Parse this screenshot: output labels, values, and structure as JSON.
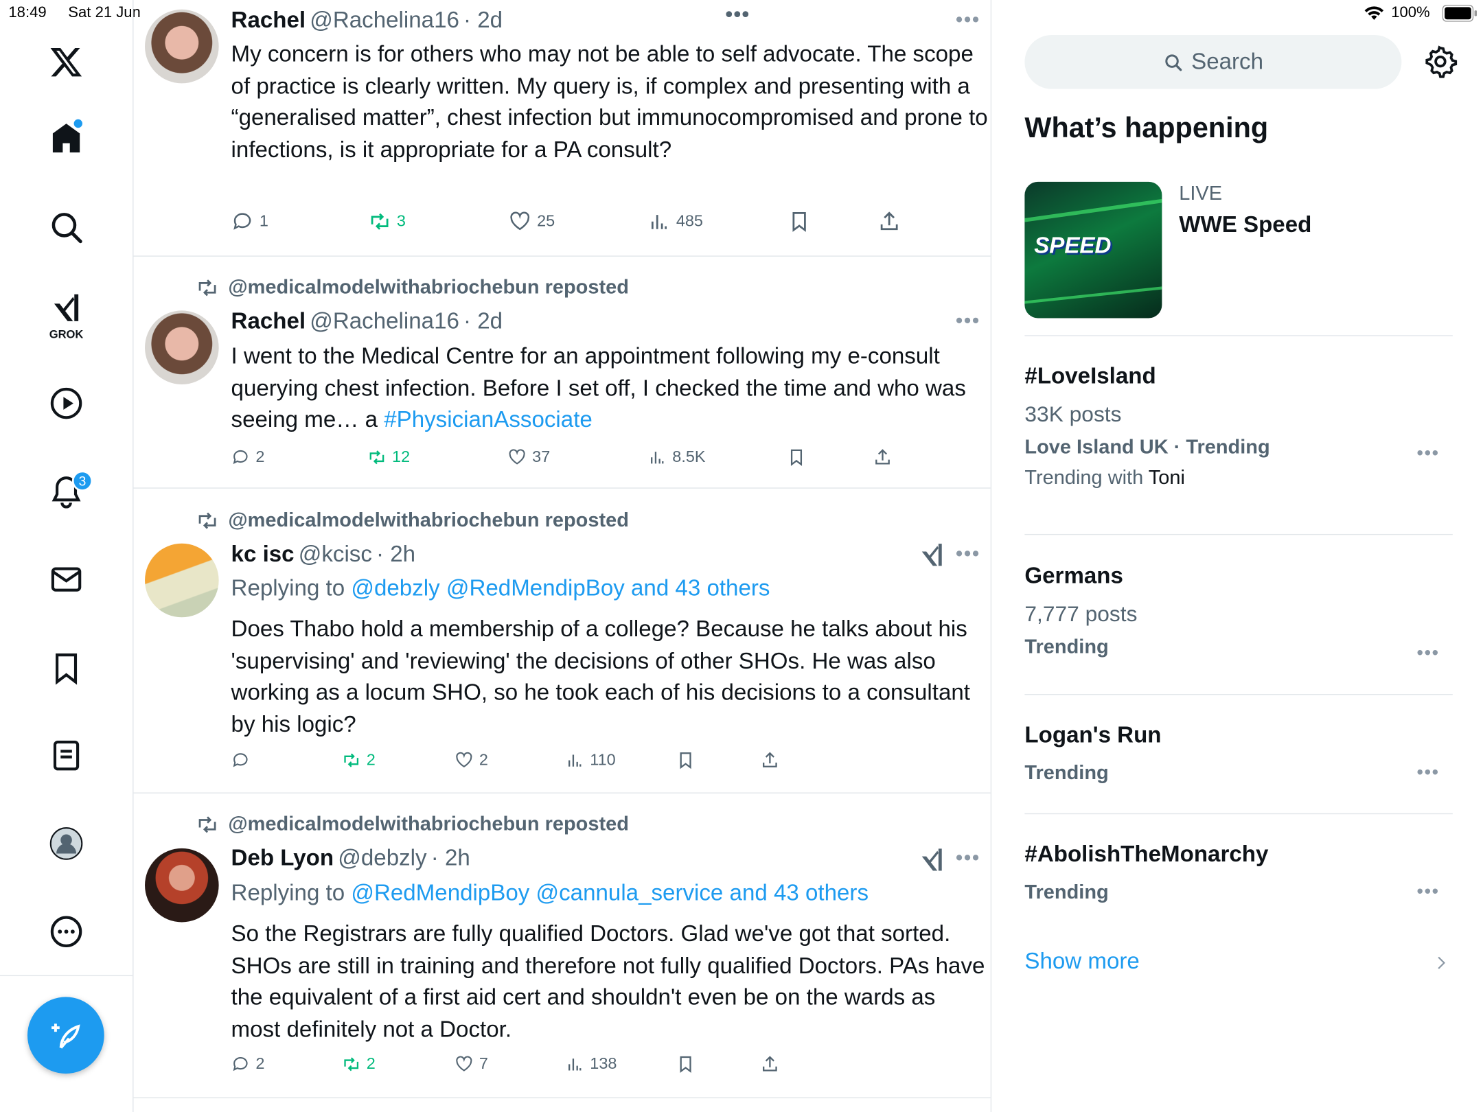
{
  "status_bar": {
    "time": "18:49",
    "date": "Sat 21 Jun",
    "battery": "100%"
  },
  "nav": {
    "grok_label": "GROK",
    "notification_count": "3"
  },
  "top_more": "•••",
  "tweets": [
    {
      "name": "Rachel",
      "handle": "@Rachelina16",
      "time": "· 2d",
      "body": "My concern is for others who may not be able to self advocate. The scope of practice is clearly written. My query is, if complex and presenting with a “generalised matter”, chest infection but immunocompromised and prone to infections, is it appropriate for a PA consult?",
      "replies": "1",
      "reposts": "3",
      "likes": "25",
      "views": "485"
    },
    {
      "reposted_by": "@medicalmodelwithabriochebun reposted",
      "name": "Rachel",
      "handle": "@Rachelina16",
      "time": "· 2d",
      "body_text": "I went to the Medical Centre for an appointment following my e-consult querying chest infection. Before I set off, I checked the time and who was seeing me… a ",
      "body_hashtag": "#PhysicianAssociate",
      "replies": "2",
      "reposts": "12",
      "likes": "37",
      "views": "8.5K"
    },
    {
      "reposted_by": "@medicalmodelwithabriochebun reposted",
      "name": "kc isc",
      "handle": "@kcisc",
      "time": "· 2h",
      "replying_prefix": "Replying to ",
      "replying_to": "@debzly @RedMendipBoy and 43 others",
      "body": "Does Thabo hold a membership of a college? Because he talks about his 'supervising' and 'reviewing'  the decisions of other SHOs. He was also working as a locum SHO, so he took each of his decisions to a consultant by his logic?",
      "replies": "",
      "reposts": "2",
      "likes": "2",
      "views": "110"
    },
    {
      "reposted_by": "@medicalmodelwithabriochebun reposted",
      "name": "Deb Lyon",
      "handle": "@debzly",
      "time": "· 2h",
      "replying_prefix": "Replying to ",
      "replying_to": "@RedMendipBoy @cannula_service and 43 others",
      "body": "So the Registrars are fully qualified Doctors. Glad we've got that sorted. SHOs are still in training and therefore not fully qualified Doctors. PAs have the equivalent of a first aid cert and shouldn't even be on the wards as most definitely not a Doctor.",
      "replies": "2",
      "reposts": "2",
      "likes": "7",
      "views": "138"
    }
  ],
  "sidebar": {
    "search_placeholder": "Search",
    "heading": "What’s happening",
    "live": {
      "label": "LIVE",
      "title": "WWE Speed",
      "thumb_text": "SPEED"
    },
    "trends": [
      {
        "title": "#LoveIsland",
        "posts": "33K posts",
        "context": "Love Island UK · Trending",
        "with_prefix": "Trending with ",
        "with_name": "Toni"
      },
      {
        "title": "Germans",
        "posts": "7,777 posts",
        "context": "Trending"
      },
      {
        "title": "Logan's Run",
        "context": "Trending"
      },
      {
        "title": "#AbolishTheMonarchy",
        "context": "Trending"
      }
    ],
    "show_more": "Show more"
  },
  "colors": {
    "accent": "#1d9bf0",
    "repost_green": "#00ba7c",
    "muted": "#536471"
  }
}
